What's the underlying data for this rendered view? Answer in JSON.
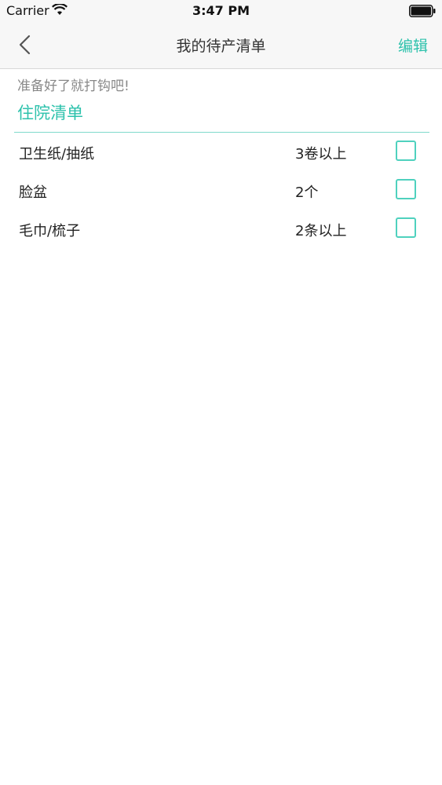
{
  "status_bar": {
    "carrier": "Carrier",
    "time": "3:47 PM"
  },
  "nav": {
    "title": "我的待产清单",
    "edit_label": "编辑"
  },
  "hint": "准备好了就打钩吧!",
  "section": {
    "title": "住院清单"
  },
  "items": [
    {
      "name": "卫生纸/抽纸",
      "qty": "3卷以上",
      "checked": false
    },
    {
      "name": "脸盆",
      "qty": "2个",
      "checked": false
    },
    {
      "name": "毛巾/梳子",
      "qty": "2条以上",
      "checked": false
    }
  ],
  "colors": {
    "accent": "#2dc2ac",
    "checkbox_border": "#4fd1be"
  }
}
